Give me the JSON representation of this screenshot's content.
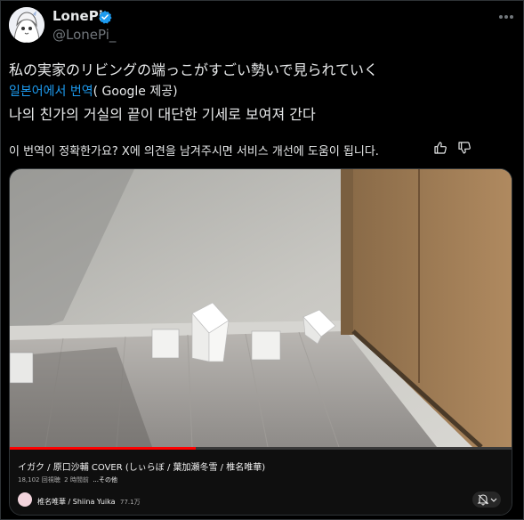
{
  "author": {
    "display_name": "LonePi",
    "handle": "@LonePi_"
  },
  "post": {
    "original_text": "私の実家のリビングの端っこがすごい勢いで見られていく",
    "translated_by_link": "일본어에서 번역",
    "translated_by_provider": "( Google 제공)",
    "translated_text": "나의 친가의 거실의 끝이 대단한 기세로 보여져 간다",
    "feedback_prompt": "이 번역이 정확한가요? X에 의견을 남겨주시면 서비스 개선에 도움이 됩니다."
  },
  "video": {
    "title": "イガク / 原口沙輔 COVER (しぃらぼ / 葉加瀬冬雪 / 椎名唯華)",
    "views": "18,102 回視聴",
    "age": "2 時間前",
    "more_label": "...その他",
    "channel": "椎名唯華 / Shiina Yuika",
    "subscribers": "77.1万",
    "progress": 0.37
  },
  "colors": {
    "accent": "#1d9bf0",
    "verified": "#1d9bf0",
    "progress": "#ff0000",
    "secondary_text": "#71767b"
  },
  "icons": {
    "verified": "verified-badge-icon",
    "more": "more-options-icon",
    "thumb_up": "thumbs-up-icon",
    "thumb_down": "thumbs-down-icon",
    "bell": "notification-bell-icon"
  }
}
